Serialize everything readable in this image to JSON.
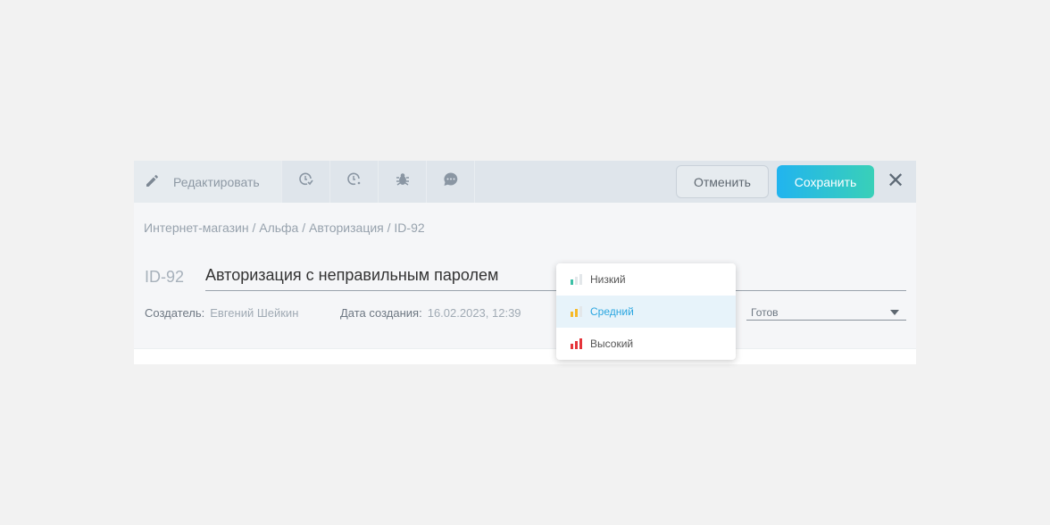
{
  "header": {
    "edit_tab": "Редактировать",
    "cancel": "Отменить",
    "save": "Сохранить"
  },
  "breadcrumb": "Интернет-магазин / Альфа / Авторизация / ID-92",
  "issue": {
    "id": "ID-92",
    "title": "Авторизация с неправильным паролем"
  },
  "meta": {
    "creator_label": "Создатель:",
    "creator": "Евгений Шейкин",
    "date_label": "Дата создания:",
    "date": "16.02.2023, 12:39"
  },
  "status": {
    "value": "Готов"
  },
  "priority_menu": {
    "items": [
      {
        "label": "Низкий",
        "color": "#3cc0a6",
        "level": 1
      },
      {
        "label": "Средний",
        "color": "#f6b928",
        "level": 2,
        "selected": true
      },
      {
        "label": "Высокий",
        "color": "#e5343a",
        "level": 3
      }
    ]
  }
}
